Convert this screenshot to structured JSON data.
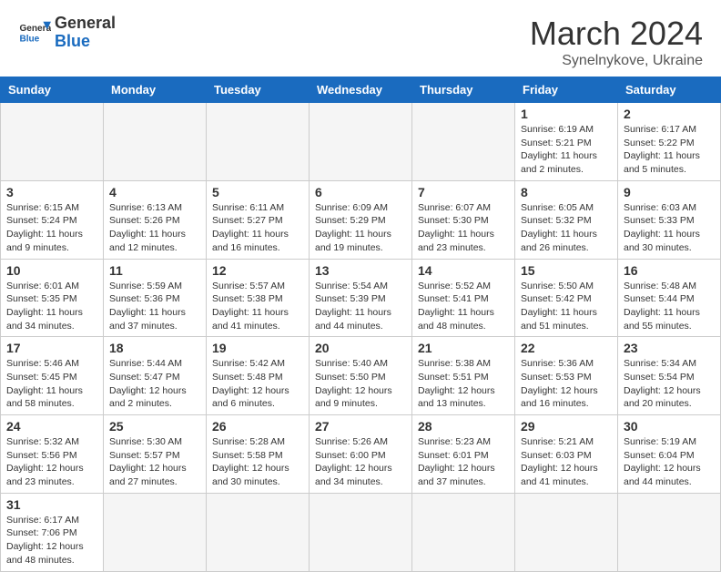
{
  "header": {
    "logo_general": "General",
    "logo_blue": "Blue",
    "title": "March 2024",
    "location": "Synelnykove, Ukraine"
  },
  "weekdays": [
    "Sunday",
    "Monday",
    "Tuesday",
    "Wednesday",
    "Thursday",
    "Friday",
    "Saturday"
  ],
  "weeks": [
    [
      {
        "day": "",
        "empty": true
      },
      {
        "day": "",
        "empty": true
      },
      {
        "day": "",
        "empty": true
      },
      {
        "day": "",
        "empty": true
      },
      {
        "day": "",
        "empty": true
      },
      {
        "day": "1",
        "sunrise": "6:19 AM",
        "sunset": "5:21 PM",
        "daylight": "11 hours and 2 minutes."
      },
      {
        "day": "2",
        "sunrise": "6:17 AM",
        "sunset": "5:22 PM",
        "daylight": "11 hours and 5 minutes."
      }
    ],
    [
      {
        "day": "3",
        "sunrise": "6:15 AM",
        "sunset": "5:24 PM",
        "daylight": "11 hours and 9 minutes."
      },
      {
        "day": "4",
        "sunrise": "6:13 AM",
        "sunset": "5:26 PM",
        "daylight": "11 hours and 12 minutes."
      },
      {
        "day": "5",
        "sunrise": "6:11 AM",
        "sunset": "5:27 PM",
        "daylight": "11 hours and 16 minutes."
      },
      {
        "day": "6",
        "sunrise": "6:09 AM",
        "sunset": "5:29 PM",
        "daylight": "11 hours and 19 minutes."
      },
      {
        "day": "7",
        "sunrise": "6:07 AM",
        "sunset": "5:30 PM",
        "daylight": "11 hours and 23 minutes."
      },
      {
        "day": "8",
        "sunrise": "6:05 AM",
        "sunset": "5:32 PM",
        "daylight": "11 hours and 26 minutes."
      },
      {
        "day": "9",
        "sunrise": "6:03 AM",
        "sunset": "5:33 PM",
        "daylight": "11 hours and 30 minutes."
      }
    ],
    [
      {
        "day": "10",
        "sunrise": "6:01 AM",
        "sunset": "5:35 PM",
        "daylight": "11 hours and 34 minutes."
      },
      {
        "day": "11",
        "sunrise": "5:59 AM",
        "sunset": "5:36 PM",
        "daylight": "11 hours and 37 minutes."
      },
      {
        "day": "12",
        "sunrise": "5:57 AM",
        "sunset": "5:38 PM",
        "daylight": "11 hours and 41 minutes."
      },
      {
        "day": "13",
        "sunrise": "5:54 AM",
        "sunset": "5:39 PM",
        "daylight": "11 hours and 44 minutes."
      },
      {
        "day": "14",
        "sunrise": "5:52 AM",
        "sunset": "5:41 PM",
        "daylight": "11 hours and 48 minutes."
      },
      {
        "day": "15",
        "sunrise": "5:50 AM",
        "sunset": "5:42 PM",
        "daylight": "11 hours and 51 minutes."
      },
      {
        "day": "16",
        "sunrise": "5:48 AM",
        "sunset": "5:44 PM",
        "daylight": "11 hours and 55 minutes."
      }
    ],
    [
      {
        "day": "17",
        "sunrise": "5:46 AM",
        "sunset": "5:45 PM",
        "daylight": "11 hours and 58 minutes."
      },
      {
        "day": "18",
        "sunrise": "5:44 AM",
        "sunset": "5:47 PM",
        "daylight": "12 hours and 2 minutes."
      },
      {
        "day": "19",
        "sunrise": "5:42 AM",
        "sunset": "5:48 PM",
        "daylight": "12 hours and 6 minutes."
      },
      {
        "day": "20",
        "sunrise": "5:40 AM",
        "sunset": "5:50 PM",
        "daylight": "12 hours and 9 minutes."
      },
      {
        "day": "21",
        "sunrise": "5:38 AM",
        "sunset": "5:51 PM",
        "daylight": "12 hours and 13 minutes."
      },
      {
        "day": "22",
        "sunrise": "5:36 AM",
        "sunset": "5:53 PM",
        "daylight": "12 hours and 16 minutes."
      },
      {
        "day": "23",
        "sunrise": "5:34 AM",
        "sunset": "5:54 PM",
        "daylight": "12 hours and 20 minutes."
      }
    ],
    [
      {
        "day": "24",
        "sunrise": "5:32 AM",
        "sunset": "5:56 PM",
        "daylight": "12 hours and 23 minutes."
      },
      {
        "day": "25",
        "sunrise": "5:30 AM",
        "sunset": "5:57 PM",
        "daylight": "12 hours and 27 minutes."
      },
      {
        "day": "26",
        "sunrise": "5:28 AM",
        "sunset": "5:58 PM",
        "daylight": "12 hours and 30 minutes."
      },
      {
        "day": "27",
        "sunrise": "5:26 AM",
        "sunset": "6:00 PM",
        "daylight": "12 hours and 34 minutes."
      },
      {
        "day": "28",
        "sunrise": "5:23 AM",
        "sunset": "6:01 PM",
        "daylight": "12 hours and 37 minutes."
      },
      {
        "day": "29",
        "sunrise": "5:21 AM",
        "sunset": "6:03 PM",
        "daylight": "12 hours and 41 minutes."
      },
      {
        "day": "30",
        "sunrise": "5:19 AM",
        "sunset": "6:04 PM",
        "daylight": "12 hours and 44 minutes."
      }
    ],
    [
      {
        "day": "31",
        "sunrise": "6:17 AM",
        "sunset": "7:06 PM",
        "daylight": "12 hours and 48 minutes."
      },
      {
        "day": "",
        "empty": true
      },
      {
        "day": "",
        "empty": true
      },
      {
        "day": "",
        "empty": true
      },
      {
        "day": "",
        "empty": true
      },
      {
        "day": "",
        "empty": true
      },
      {
        "day": "",
        "empty": true
      }
    ]
  ]
}
